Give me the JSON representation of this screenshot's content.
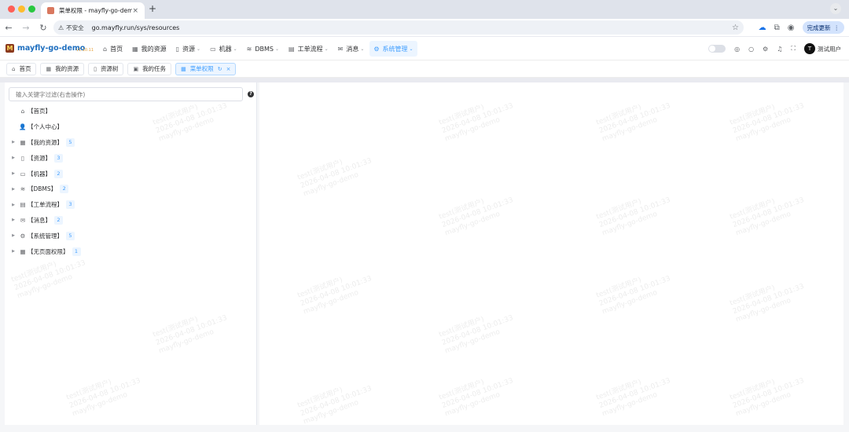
{
  "browser": {
    "tab_title": "菜单权限 - mayfly-go-demo",
    "insecure_label": "不安全",
    "url": "go.mayfly.run/sys/resources",
    "update_button": "完成更新"
  },
  "app": {
    "name": "mayfly-go-demo",
    "version": "v1.10.11",
    "menu": [
      {
        "label": "首页",
        "icon": "home-icon",
        "glyph": "⌂",
        "dropdown": false,
        "active": false
      },
      {
        "label": "我的资源",
        "icon": "grid-icon",
        "glyph": "▦",
        "dropdown": false,
        "active": false
      },
      {
        "label": "资源",
        "icon": "bookmark-icon",
        "glyph": "▯",
        "dropdown": true,
        "active": false
      },
      {
        "label": "机器",
        "icon": "monitor-icon",
        "glyph": "▭",
        "dropdown": true,
        "active": false
      },
      {
        "label": "DBMS",
        "icon": "database-icon",
        "glyph": "≋",
        "dropdown": true,
        "active": false
      },
      {
        "label": "工单流程",
        "icon": "clipboard-icon",
        "glyph": "▤",
        "dropdown": true,
        "active": false
      },
      {
        "label": "消息",
        "icon": "mail-icon",
        "glyph": "✉",
        "dropdown": true,
        "active": false
      },
      {
        "label": "系统管理",
        "icon": "gear-icon",
        "glyph": "⚙",
        "dropdown": true,
        "active": true
      }
    ],
    "user_initial": "T",
    "user_name": "测试用户"
  },
  "tags": [
    {
      "label": "首页",
      "icon": "home-icon",
      "glyph": "⌂",
      "active": false
    },
    {
      "label": "我的资源",
      "icon": "grid-icon",
      "glyph": "▦",
      "active": false
    },
    {
      "label": "资源树",
      "icon": "bookmark-icon",
      "glyph": "▯",
      "active": false
    },
    {
      "label": "我的任务",
      "icon": "task-icon",
      "glyph": "▣",
      "active": false
    },
    {
      "label": "菜单权限",
      "icon": "grid-icon",
      "glyph": "▦",
      "active": true
    }
  ],
  "filter": {
    "placeholder": "输入关键字过滤(右击操作)"
  },
  "tree": [
    {
      "label": "【首页】",
      "icon": "home-icon",
      "glyph": "⌂",
      "expandable": false,
      "count": ""
    },
    {
      "label": "【个人中心】",
      "icon": "user-icon",
      "glyph": "👤",
      "expandable": false,
      "count": ""
    },
    {
      "label": "【我的资源】",
      "icon": "grid-icon",
      "glyph": "▦",
      "expandable": true,
      "count": "5"
    },
    {
      "label": "【资源】",
      "icon": "bookmark-icon",
      "glyph": "▯",
      "expandable": true,
      "count": "3"
    },
    {
      "label": "【机器】",
      "icon": "monitor-icon",
      "glyph": "▭",
      "expandable": true,
      "count": "2"
    },
    {
      "label": "【DBMS】",
      "icon": "database-icon",
      "glyph": "≋",
      "expandable": true,
      "count": "2"
    },
    {
      "label": "【工单流程】",
      "icon": "clipboard-icon",
      "glyph": "▤",
      "expandable": true,
      "count": "3"
    },
    {
      "label": "【消息】",
      "icon": "mail-icon",
      "glyph": "✉",
      "expandable": true,
      "count": "2"
    },
    {
      "label": "【系统管理】",
      "icon": "gear-icon",
      "glyph": "⚙",
      "expandable": true,
      "count": "5"
    },
    {
      "label": "【无页面权限】",
      "icon": "grid-icon",
      "glyph": "▦",
      "expandable": true,
      "count": "1"
    }
  ],
  "watermark": {
    "line1": "test(测试用户)",
    "line2": "2026-04-08 10:01:33",
    "line3": "mayfly-go-demo"
  }
}
